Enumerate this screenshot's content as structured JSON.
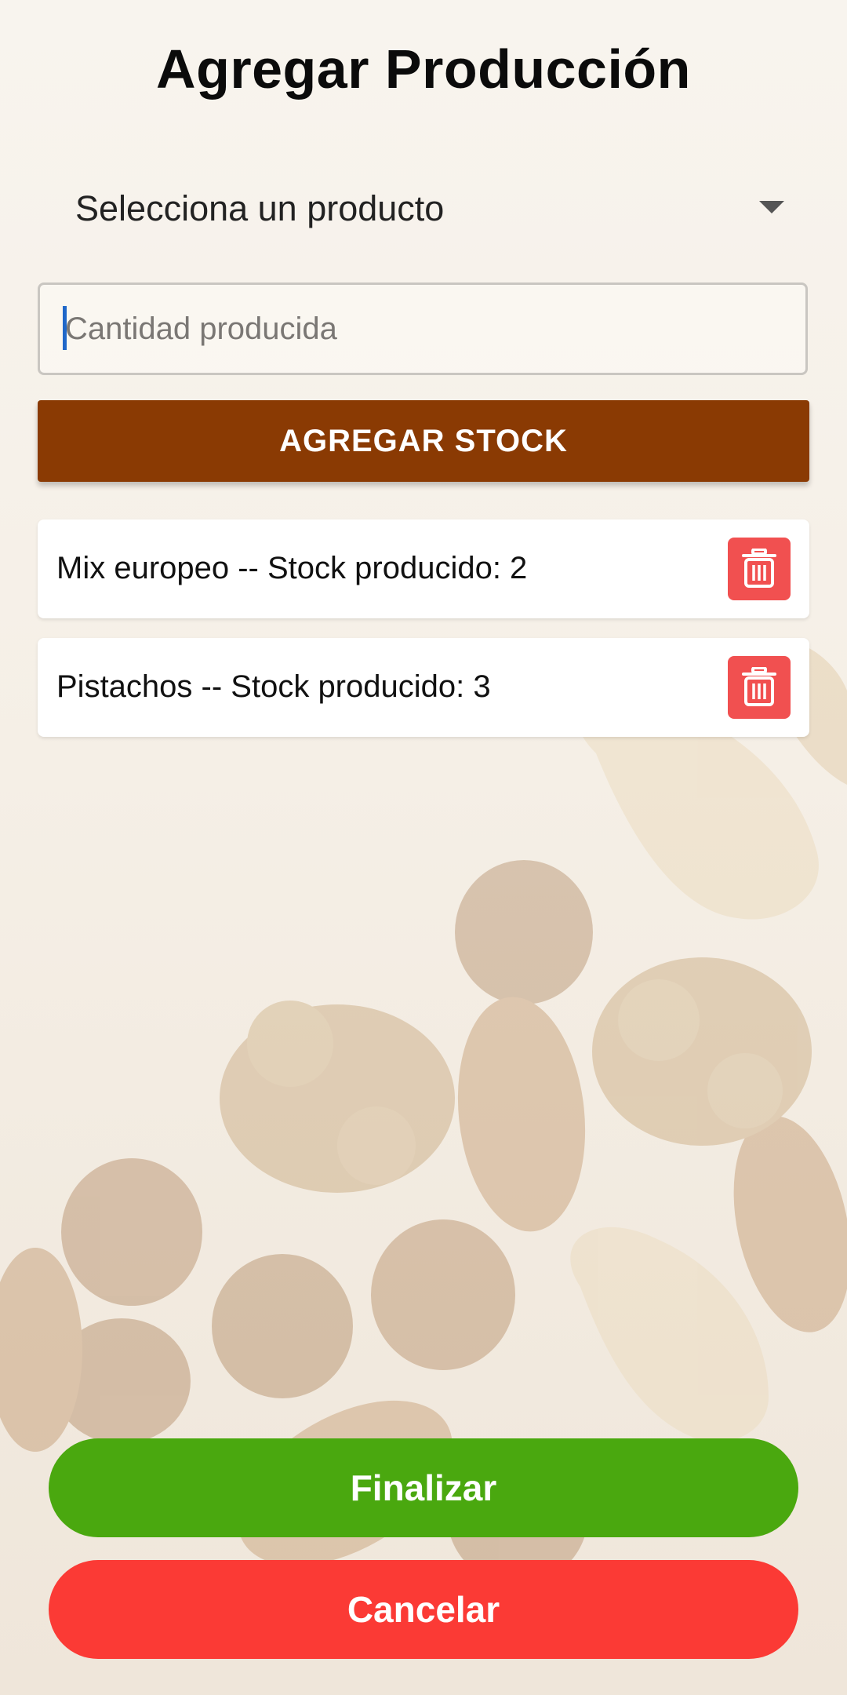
{
  "header": {
    "title": "Agregar Producción"
  },
  "product_select": {
    "selected_label": "Selecciona un producto",
    "caret_icon": "chevron-down-icon"
  },
  "quantity_input": {
    "placeholder": "Cantidad producida",
    "value": ""
  },
  "add_stock_button": {
    "label": "AGREGAR STOCK"
  },
  "production_items": [
    {
      "label": "Mix europeo -- Stock producido: 2",
      "delete_icon": "trash-icon"
    },
    {
      "label": "Pistachos -- Stock producido: 3",
      "delete_icon": "trash-icon"
    }
  ],
  "footer": {
    "finish_label": "Finalizar",
    "cancel_label": "Cancelar"
  },
  "colors": {
    "add_button": "#8a3a03",
    "delete_button": "#f15050",
    "finish_button": "#4aa80f",
    "cancel_button": "#fb3a35"
  }
}
